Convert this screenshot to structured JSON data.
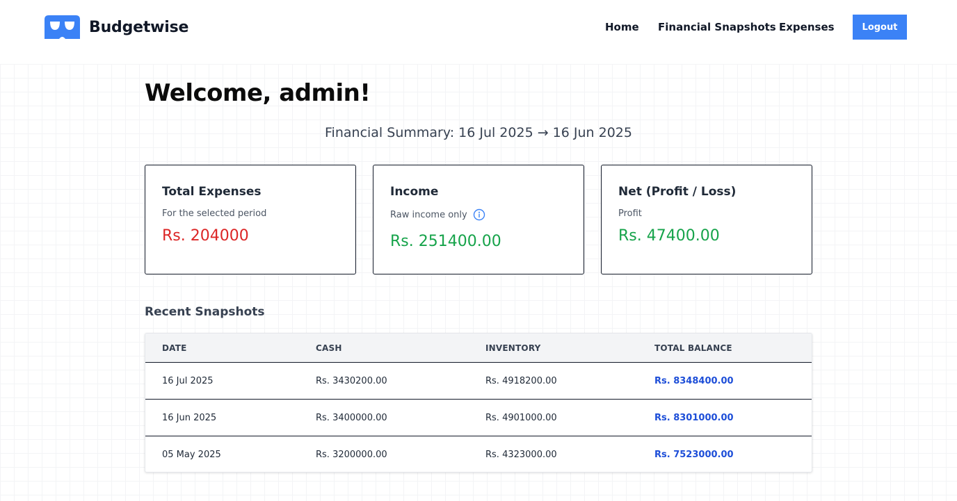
{
  "app": {
    "name": "Budgetwise",
    "logo_icon": "glasses-mask-icon",
    "accent_color": "#3b82f6"
  },
  "nav": {
    "home": "Home",
    "snapshots": "Financial Snapshots",
    "expenses": "Expenses",
    "logout": "Logout"
  },
  "welcome": "Welcome, admin!",
  "summary": "Financial Summary: 16 Jul 2025 → 16 Jun 2025",
  "cards": [
    {
      "title": "Total Expenses",
      "subtitle": "For the selected period",
      "value": "Rs. 204000",
      "color": "#dc2626"
    },
    {
      "title": "Income",
      "subtitle": "Raw income only",
      "value": "Rs. 251400.00",
      "color": "#16a34a",
      "icon": "info-icon"
    },
    {
      "title": "Net (Profit / Loss)",
      "subtitle": "Profit",
      "value": "Rs. 47400.00",
      "color": "#16a34a"
    }
  ],
  "snapshots": {
    "title": "Recent Snapshots",
    "columns": [
      "DATE",
      "CASH",
      "INVENTORY",
      "TOTAL BALANCE"
    ],
    "rows": [
      {
        "date": "16 Jul 2025",
        "cash": "Rs. 3430200.00",
        "inventory": "Rs. 4918200.00",
        "total": "Rs. 8348400.00"
      },
      {
        "date": "16 Jun 2025",
        "cash": "Rs. 3400000.00",
        "inventory": "Rs. 4901000.00",
        "total": "Rs. 8301000.00"
      },
      {
        "date": "05 May 2025",
        "cash": "Rs. 3200000.00",
        "inventory": "Rs. 4323000.00",
        "total": "Rs. 7523000.00"
      }
    ]
  }
}
